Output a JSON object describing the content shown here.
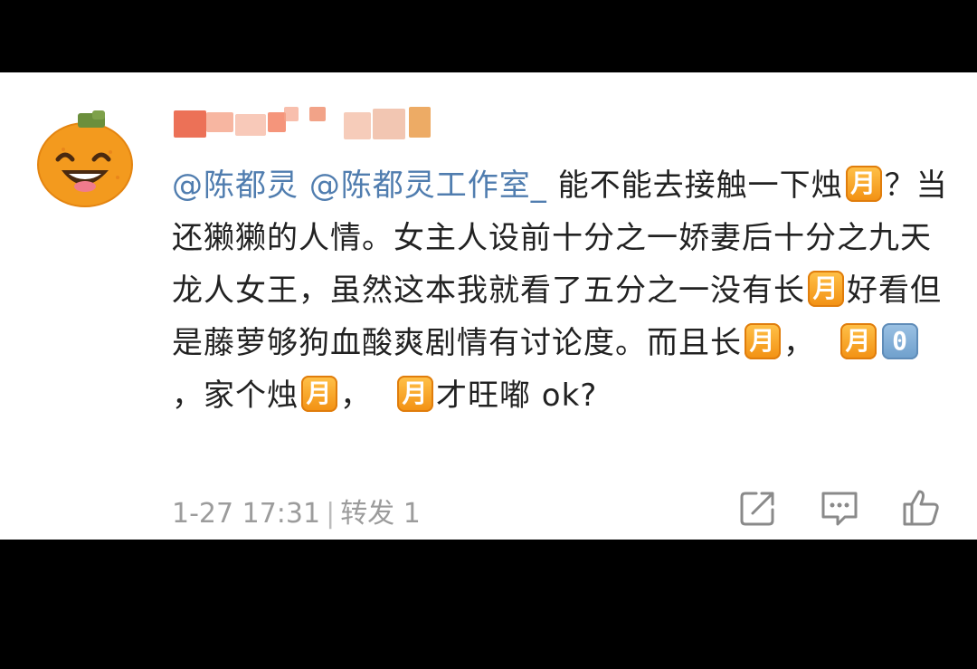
{
  "comment": {
    "mention_1": "@陈都灵",
    "mention_2": "@陈都灵工作室_",
    "text_1": " 能不能去接触一下烛",
    "emoji_1": "月",
    "text_2": "？当还獭獭的人情。女主人设前十分之一娇妻后十分之九天龙人女王，虽然这本我就看了五分之一没有长",
    "emoji_2": "月",
    "text_3": "好看但是藤萝够狗血酸爽剧情有讨论度。而且长",
    "emoji_3": "月",
    "text_4": "，",
    "emoji_4": "月",
    "emoji_5": "0",
    "text_5": "，家个烛",
    "emoji_6": "月",
    "text_6": "，",
    "emoji_7": "月",
    "text_7": "才旺嘟 ok?"
  },
  "meta": {
    "timestamp": "1-27 17:31",
    "separator": "|",
    "repost_label": "转发 1"
  },
  "actions": {
    "share_icon": "share-icon",
    "comment_icon": "comment-icon",
    "like_icon": "like-icon"
  },
  "colors": {
    "mention": "#507daf",
    "emoji_orange": "#f5a623",
    "emoji_blue": "#7aa7d2",
    "meta_text": "#9c9c9c"
  }
}
